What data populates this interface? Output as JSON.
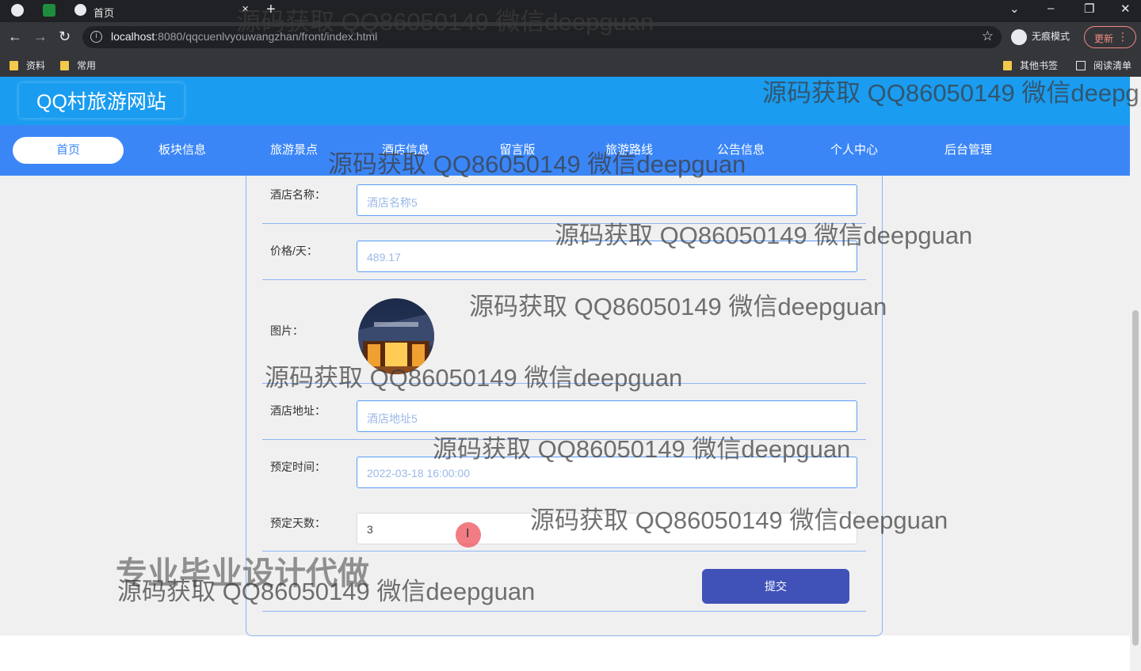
{
  "browser": {
    "tab_title": "首页",
    "tab_close": "×",
    "new_tab": "+",
    "url_host": "localhost",
    "url_path": ":8080/qqcuenlvyouwangzhan/front/index.html",
    "incognito_label": "无痕模式",
    "update_label": "更新",
    "bookmarks": [
      "资料",
      "常用"
    ],
    "bookmarks_right": [
      "其他书签",
      "阅读清单"
    ]
  },
  "site": {
    "title": "QQ村旅游网站",
    "nav": [
      "首页",
      "板块信息",
      "旅游景点",
      "酒店信息",
      "留言版",
      "旅游路线",
      "公告信息",
      "个人中心",
      "后台管理"
    ]
  },
  "form": {
    "hotel_name": {
      "label": "酒店名称：",
      "value": "酒店名称5"
    },
    "price": {
      "label": "价格/天：",
      "value": "489.17"
    },
    "image": {
      "label": "图片："
    },
    "address": {
      "label": "酒店地址：",
      "value": "酒店地址5"
    },
    "booking_time": {
      "label": "预定时间：",
      "value": "2022-03-18 16:00:00"
    },
    "days": {
      "label": "预定天数：",
      "value": "3"
    },
    "submit_label": "提交"
  },
  "watermarks": {
    "text": "源码获取 QQ86050149 微信deepguan",
    "text_cut": "源码获取 QQ86050149 微信deepg",
    "promo": "专业毕业设计代做"
  },
  "colors": {
    "header": "#1a9cf0",
    "nav": "#3b86f7",
    "submit": "#4051b8",
    "border": "#8fb4f3"
  }
}
